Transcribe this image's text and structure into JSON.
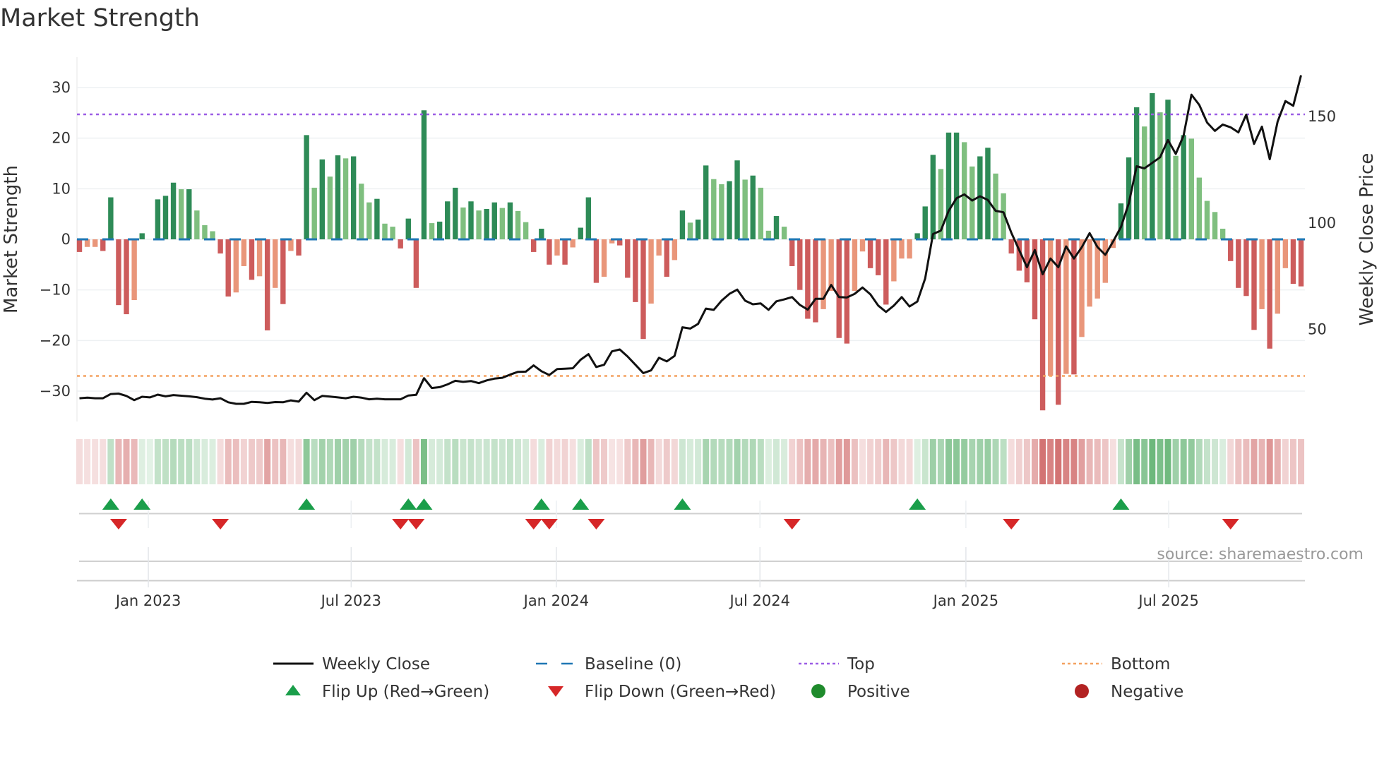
{
  "title": "Market Strength",
  "source": "source: sharemaestro.com",
  "colors": {
    "strong_green": "#2e8b57",
    "weak_green": "#7fbf7f",
    "strong_red": "#cd5c5c",
    "weak_red": "#e9967a",
    "baseline": "#1f77b4",
    "top": "#9b5de5",
    "bottom": "#f4a261",
    "close": "#111111",
    "flip_up": "#1a9e4a",
    "flip_down": "#d62728",
    "positive": "#1f8b2c",
    "negative": "#b22222"
  },
  "chart_data": {
    "type": "bar",
    "title": "Market Strength",
    "start_week": "2022-10-31",
    "frequency": "weekly",
    "ylabel": "Market Strength",
    "y2label": "Weekly Close Price",
    "ylim": [
      -36,
      36
    ],
    "y2lim": [
      6.8,
      177.8
    ],
    "yticks": [
      30,
      20,
      10,
      0,
      -10,
      -20,
      -30
    ],
    "y2ticks": [
      150,
      100,
      50
    ],
    "xticks": [
      "Jan 2023",
      "Jul 2023",
      "Jan 2024",
      "Jul 2024",
      "Jan 2025",
      "Jul 2025"
    ],
    "xtick_week_index": [
      8.8,
      34.7,
      60.9,
      86.9,
      113.2,
      139.1
    ],
    "top_level": 24.7,
    "bottom_level": -27,
    "baseline": 0,
    "strength": [
      -2.5,
      -1.5,
      -1.5,
      -2.3,
      8.3,
      -13,
      -14.8,
      -12,
      1.2,
      0,
      7.9,
      8.6,
      11.2,
      9.9,
      9.9,
      5.7,
      2.8,
      1.6,
      -2.8,
      -11.3,
      -10.5,
      -5.3,
      -8,
      -7.3,
      -18,
      -9.6,
      -12.8,
      -2.3,
      -3.2,
      20.6,
      10.2,
      15.8,
      12.4,
      16.6,
      16,
      16.4,
      11,
      7.3,
      8,
      3.1,
      2.5,
      -1.8,
      4.1,
      -9.6,
      25.5,
      3.2,
      3.5,
      7.5,
      10.2,
      6.3,
      7.5,
      5.7,
      6,
      7.3,
      6.2,
      7.3,
      5.6,
      3.4,
      -2.5,
      2.1,
      -5,
      -3.2,
      -5,
      -1.6,
      2.3,
      8.3,
      -8.6,
      -7.4,
      -0.8,
      -1.2,
      -7.6,
      -12.4,
      -19.7,
      -12.7,
      -3.2,
      -7.4,
      -4.1,
      5.7,
      3.3,
      3.9,
      14.6,
      11.9,
      10.9,
      11.5,
      15.6,
      11.8,
      12.6,
      10.2,
      1.7,
      4.6,
      2.5,
      -5.3,
      -10,
      -15.7,
      -16.4,
      -13.8,
      -10.2,
      -19.5,
      -20.6,
      -10.2,
      -2.4,
      -5.7,
      -7.1,
      -12.9,
      -8.3,
      -3.8,
      -3.8,
      1.2,
      6.5,
      16.7,
      13.9,
      21.1,
      21.1,
      19.2,
      14.4,
      16.4,
      18.1,
      13,
      9.1,
      -2.8,
      -6.2,
      -8.5,
      -15.8,
      -33.8,
      -27,
      -32.7,
      -26.6,
      -26.7,
      -19.3,
      -13.3,
      -11.7,
      -8.6,
      -1.7,
      7.1,
      16.2,
      26.1,
      22.3,
      28.9,
      25.1,
      27.6,
      16.5,
      20.6,
      19.9,
      12.2,
      7.6,
      5.4,
      2.1,
      -4.3,
      -9.6,
      -11.2,
      -17.9,
      -13.8,
      -21.6,
      -14.7,
      -5.7,
      -8.8,
      -9.3
    ],
    "shade": "DLLDDDDLDDDDDLDLLLDDLLDLDLDLDDLDLDLDLLDLLDDDDLDDDLDLDDLDLLDDDLDLDDDLLDDDDLLDLDLDDLLDDLDLLDLDDDDLLDDLLDDDLLLDDDLDDLLDDLLDDDDDLDLDLLLLLDDDLDLDLDLLLLLDDDDLDLLDD",
    "weekly_close": [
      17.7,
      18.0,
      17.7,
      17.7,
      19.7,
      19.9,
      18.8,
      16.8,
      18.4,
      18.1,
      19.4,
      18.6,
      19.2,
      18.9,
      18.6,
      18.2,
      17.5,
      17.1,
      17.7,
      15.8,
      15.1,
      15.1,
      16.0,
      15.8,
      15.5,
      15.9,
      15.8,
      16.7,
      16.1,
      20.3,
      16.8,
      18.8,
      18.5,
      18.1,
      17.7,
      18.4,
      18.0,
      17.2,
      17.5,
      17.2,
      17.2,
      17.2,
      19.0,
      19.3,
      27.1,
      22.5,
      22.9,
      24.2,
      25.9,
      25.4,
      25.8,
      24.8,
      26.1,
      26.9,
      27.3,
      28.8,
      30.1,
      30.2,
      33.1,
      30.4,
      28.6,
      31.4,
      31.6,
      31.8,
      35.8,
      38.4,
      32.4,
      33.4,
      39.7,
      40.6,
      37.3,
      33.4,
      29.5,
      30.8,
      36.7,
      35.0,
      37.6,
      51.0,
      50.4,
      52.6,
      59.8,
      59.2,
      63.5,
      66.7,
      68.7,
      63.5,
      61.8,
      62.2,
      59.2,
      63.2,
      64.1,
      65.2,
      61.5,
      59.3,
      64.4,
      64.4,
      70.9,
      65.2,
      65.0,
      66.7,
      69.7,
      66.5,
      61.2,
      58.2,
      61.2,
      65.2,
      60.8,
      63.1,
      73.9,
      94.8,
      96.4,
      105.7,
      111.6,
      113.4,
      110.5,
      112.5,
      110.8,
      105.7,
      105.0,
      95.4,
      87.3,
      79.2,
      87.3,
      75.9,
      83.3,
      79.2,
      89.0,
      83.3,
      88.6,
      95.2,
      88.7,
      85.0,
      91.3,
      98.1,
      109.2,
      126.6,
      125.6,
      128.2,
      130.8,
      138.9,
      132.4,
      141.0,
      160.2,
      155.4,
      147.1,
      143.2,
      146.2,
      144.9,
      142.5,
      150.8,
      137.1,
      145.2,
      129.9,
      147.5,
      157.2,
      155.0,
      169.3
    ],
    "flip_up_week_index": [
      4,
      8,
      29,
      42,
      44,
      59,
      64,
      77,
      107,
      133
    ],
    "flip_down_week_index": [
      5,
      18,
      41,
      43,
      58,
      60,
      66,
      91,
      119,
      147
    ],
    "legend": {
      "placement": "bottom",
      "items": [
        {
          "key": "close",
          "label": "Weekly Close"
        },
        {
          "key": "baseline",
          "label": "Baseline (0)"
        },
        {
          "key": "top",
          "label": "Top"
        },
        {
          "key": "bottom",
          "label": "Bottom"
        },
        {
          "key": "flip_up",
          "label": "Flip Up (Red→Green)"
        },
        {
          "key": "flip_down",
          "label": "Flip Down (Green→Red)"
        },
        {
          "key": "positive",
          "label": "Positive"
        },
        {
          "key": "negative",
          "label": "Negative"
        }
      ]
    }
  }
}
